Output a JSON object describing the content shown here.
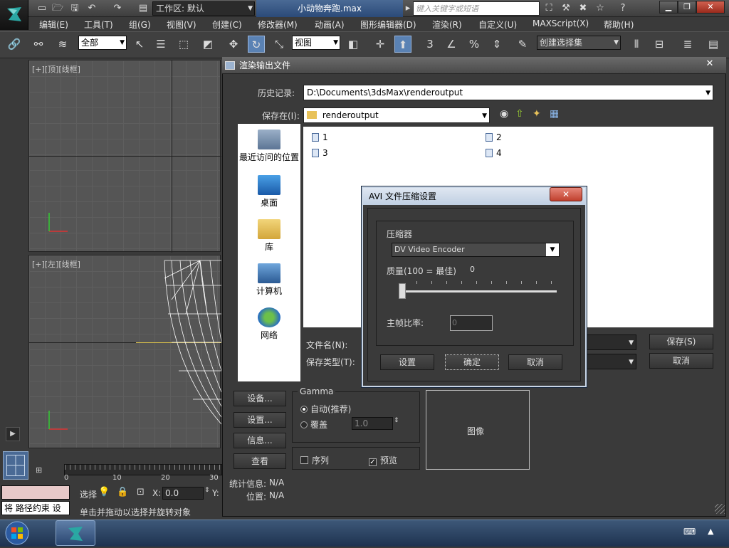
{
  "titlebar": {
    "workspace_label": "工作区: 默认",
    "document_title": "小动物奔跑.max",
    "search_placeholder": "键入关键字或短语"
  },
  "menu": {
    "items": [
      "编辑(E)",
      "工具(T)",
      "组(G)",
      "视图(V)",
      "创建(C)",
      "修改器(M)",
      "动画(A)",
      "图形编辑器(D)",
      "渲染(R)",
      "自定义(U)",
      "MAXScript(X)",
      "帮助(H)"
    ]
  },
  "toolbar": {
    "filter_value": "全部",
    "refcoord_value": "视图",
    "selection_set_placeholder": "创建选择集"
  },
  "viewports": {
    "top_label": "[+][顶][线框]",
    "left_label": "[+][左][线框]"
  },
  "timeline": {
    "ticks": [
      "0",
      "10",
      "20",
      "30"
    ]
  },
  "status": {
    "selection_label": "选择",
    "x_label": "X:",
    "x_value": "0.0",
    "y_label": "Y:",
    "left_text": "将 路径约束 设",
    "prompt_text": "单击并拖动以选择并旋转对象"
  },
  "render_dialog": {
    "title": "渲染输出文件",
    "history_label": "历史记录:",
    "history_value": "D:\\Documents\\3dsMax\\renderoutput",
    "savein_label": "保存在(I):",
    "savein_value": "renderoutput",
    "places": [
      "最近访问的位置",
      "桌面",
      "库",
      "计算机",
      "网络"
    ],
    "files": [
      "1",
      "2",
      "3",
      "4"
    ],
    "filename_label": "文件名(N):",
    "filetype_label": "保存类型(T):",
    "save_button": "保存(S)",
    "cancel_button": "取消",
    "devices_button": "设备...",
    "setup_button": "设置...",
    "info_button": "信息...",
    "view_button": "查看",
    "gamma_title": "Gamma",
    "gamma_auto": "自动(推荐)",
    "gamma_override": "覆盖",
    "gamma_value": "1.0",
    "sequence_label": "序列",
    "preview_label": "预览",
    "image_label": "图像",
    "stats_label": "统计信息:",
    "stats_value": "N/A",
    "location_label": "位置:",
    "location_value": "N/A"
  },
  "avi_dialog": {
    "title": "AVI 文件压缩设置",
    "compressor_label": "压缩器",
    "compressor_value": "DV Video Encoder",
    "quality_label": "质量(100 = 最佳)",
    "quality_value": "0",
    "keyframe_label": "主帧比率:",
    "keyframe_value": "0",
    "setup_button": "设置",
    "ok_button": "确定",
    "cancel_button": "取消"
  }
}
